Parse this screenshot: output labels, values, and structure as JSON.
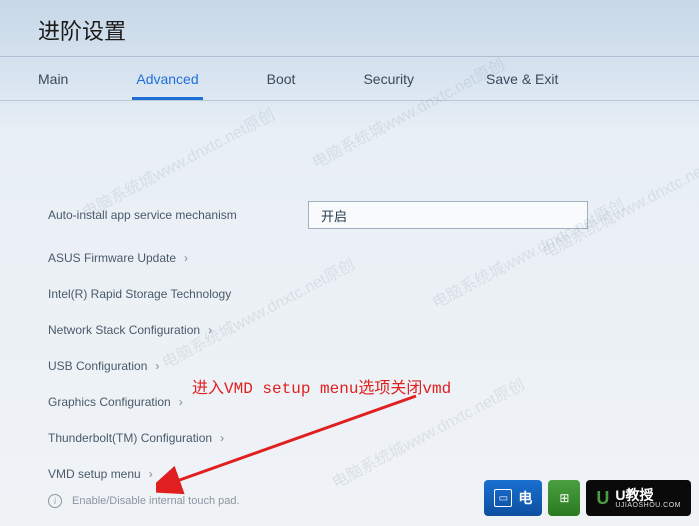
{
  "title": "进阶设置",
  "tabs": [
    {
      "label": "Main",
      "active": false
    },
    {
      "label": "Advanced",
      "active": true
    },
    {
      "label": "Boot",
      "active": false
    },
    {
      "label": "Security",
      "active": false
    },
    {
      "label": "Save & Exit",
      "active": false
    }
  ],
  "settings": {
    "auto_service": {
      "label": "Auto-install app service mechanism",
      "value": "开启"
    },
    "items": [
      {
        "label": "ASUS Firmware Update"
      },
      {
        "label": "Intel(R) Rapid Storage Technology"
      },
      {
        "label": "Network Stack Configuration"
      },
      {
        "label": "USB Configuration"
      },
      {
        "label": "Graphics Configuration"
      },
      {
        "label": "Thunderbolt(TM) Configuration"
      },
      {
        "label": "VMD setup menu"
      }
    ]
  },
  "hint": "Enable/Disable internal touch pad.",
  "annotation": "进入VMD setup menu选项关闭vmd",
  "watermark": "电脑系统城www.dnxtc.net原创",
  "badges": {
    "dian": "电",
    "u_main": "U教授",
    "u_sub": "UJIAOSHOU.COM"
  }
}
